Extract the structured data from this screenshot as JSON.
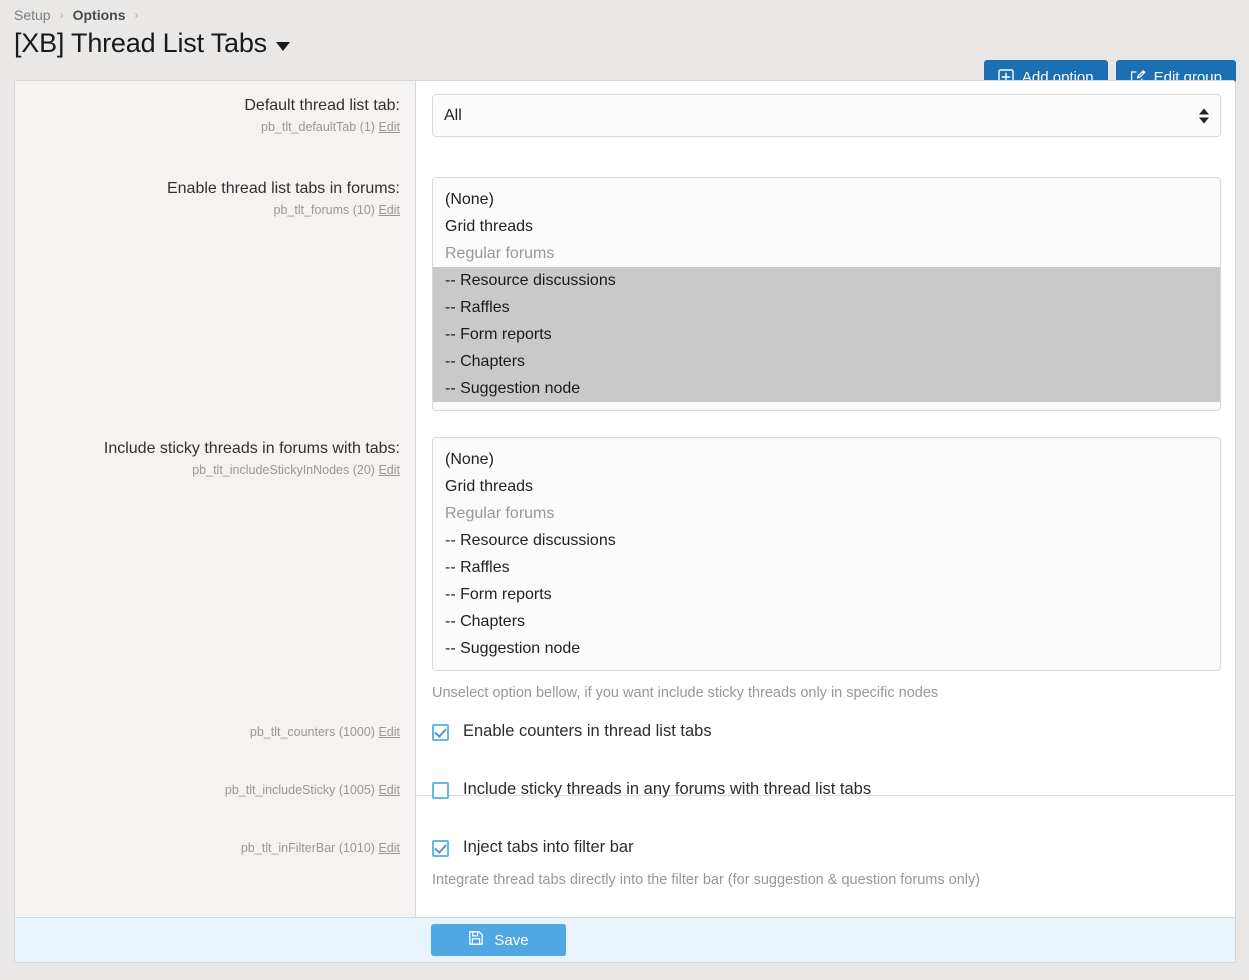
{
  "breadcrumb": {
    "items": [
      {
        "label": "Setup",
        "strong": false
      },
      {
        "label": "Options",
        "strong": true
      }
    ],
    "separator": "›"
  },
  "header": {
    "title": "[XB] Thread List Tabs",
    "dropdown_icon": "caret-down-icon",
    "actions": {
      "add_option": "Add option",
      "edit_group": "Edit group"
    }
  },
  "rows": {
    "default_tab": {
      "label": "Default thread list tab:",
      "meta_key": "pb_tlt_defaultTab (1)",
      "edit": "Edit",
      "value": "All",
      "options": [
        "All"
      ]
    },
    "forums": {
      "label": "Enable thread list tabs in forums:",
      "meta_key": "pb_tlt_forums (10)",
      "edit": "Edit",
      "options": [
        {
          "label": "(None)",
          "group": false,
          "selected": false
        },
        {
          "label": "Grid threads",
          "group": false,
          "selected": false
        },
        {
          "label": "Regular forums",
          "group": true,
          "selected": false
        },
        {
          "label": "-- Resource discussions",
          "group": false,
          "selected": true
        },
        {
          "label": "-- Raffles",
          "group": false,
          "selected": true
        },
        {
          "label": "-- Form reports",
          "group": false,
          "selected": true
        },
        {
          "label": "-- Chapters",
          "group": false,
          "selected": true
        },
        {
          "label": "-- Suggestion node",
          "group": false,
          "selected": true
        }
      ]
    },
    "sticky_nodes": {
      "label": "Include sticky threads in forums with tabs:",
      "meta_key": "pb_tlt_includeStickyInNodes (20)",
      "edit": "Edit",
      "help": "Unselect option bellow, if you want include sticky threads only in specific nodes",
      "options": [
        {
          "label": "(None)",
          "group": false,
          "selected": false
        },
        {
          "label": "Grid threads",
          "group": false,
          "selected": false
        },
        {
          "label": "Regular forums",
          "group": true,
          "selected": false
        },
        {
          "label": "-- Resource discussions",
          "group": false,
          "selected": false
        },
        {
          "label": "-- Raffles",
          "group": false,
          "selected": false
        },
        {
          "label": "-- Form reports",
          "group": false,
          "selected": false
        },
        {
          "label": "-- Chapters",
          "group": false,
          "selected": false
        },
        {
          "label": "-- Suggestion node",
          "group": false,
          "selected": false
        }
      ]
    },
    "counters": {
      "meta_key": "pb_tlt_counters (1000)",
      "edit": "Edit",
      "label": "Enable counters in thread list tabs",
      "checked": true
    },
    "include_sticky": {
      "meta_key": "pb_tlt_includeSticky (1005)",
      "edit": "Edit",
      "label": "Include sticky threads in any forums with thread list tabs",
      "checked": false
    },
    "in_filter_bar": {
      "meta_key": "pb_tlt_inFilterBar (1010)",
      "edit": "Edit",
      "label": "Inject tabs into filter bar",
      "checked": true,
      "desc": "Integrate thread tabs directly into the filter bar (for suggestion & question forums only)"
    }
  },
  "footer": {
    "save_label": "Save",
    "save_icon": "floppy-disk-icon"
  },
  "colors": {
    "brand_blue": "#1c6fb3",
    "save_blue": "#4fa8e3",
    "checkbox_blue": "#63b8e8",
    "selection_gray": "#c9c9c9",
    "footer_bg": "#e8f3fb",
    "page_bg": "#e9e8e7"
  }
}
